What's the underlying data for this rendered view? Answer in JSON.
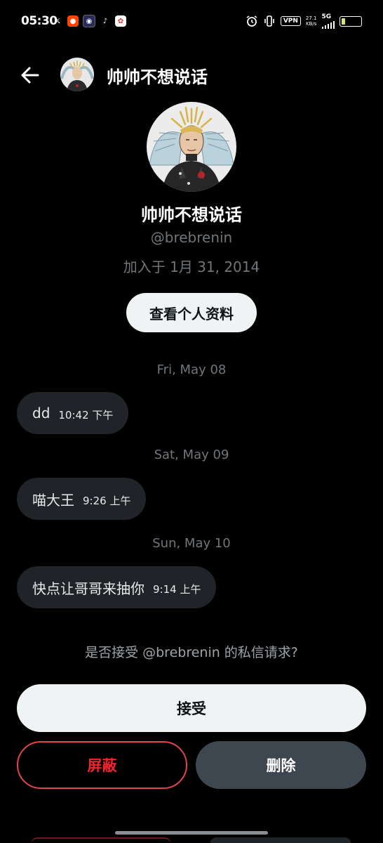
{
  "status_bar": {
    "time": "05:30",
    "vpn": "VPN",
    "net_speed_value": "27.1",
    "net_speed_unit": "KB/s",
    "network": "5G",
    "app_icons": [
      "x-icon",
      "reddit-icon",
      "app-icon",
      "tiktok-icon",
      "app-store-icon"
    ]
  },
  "header": {
    "title": "帅帅不想说话"
  },
  "profile": {
    "name": "帅帅不想说话",
    "handle": "@brebrenin",
    "joined": "加入于 1月 31, 2014",
    "view_profile_label": "查看个人资料"
  },
  "messages": [
    {
      "date": "Fri, May 08",
      "text": "dd",
      "time": "10:42 下午"
    },
    {
      "date": "Sat, May 09",
      "text": "喵大王",
      "time": "9:26 上午"
    },
    {
      "date": "Sun, May 10",
      "text": "快点让哥哥来抽你",
      "time": "9:14 上午"
    }
  ],
  "request": {
    "question": "是否接受 @brebrenin 的私信请求?",
    "accept_label": "接受",
    "block_label": "屏蔽",
    "delete_label": "删除"
  },
  "colors": {
    "background": "#000000",
    "bubble": "#202327",
    "secondary_text": "#71767b",
    "block_red": "#f4212e",
    "delete_gray": "#3e4750"
  }
}
